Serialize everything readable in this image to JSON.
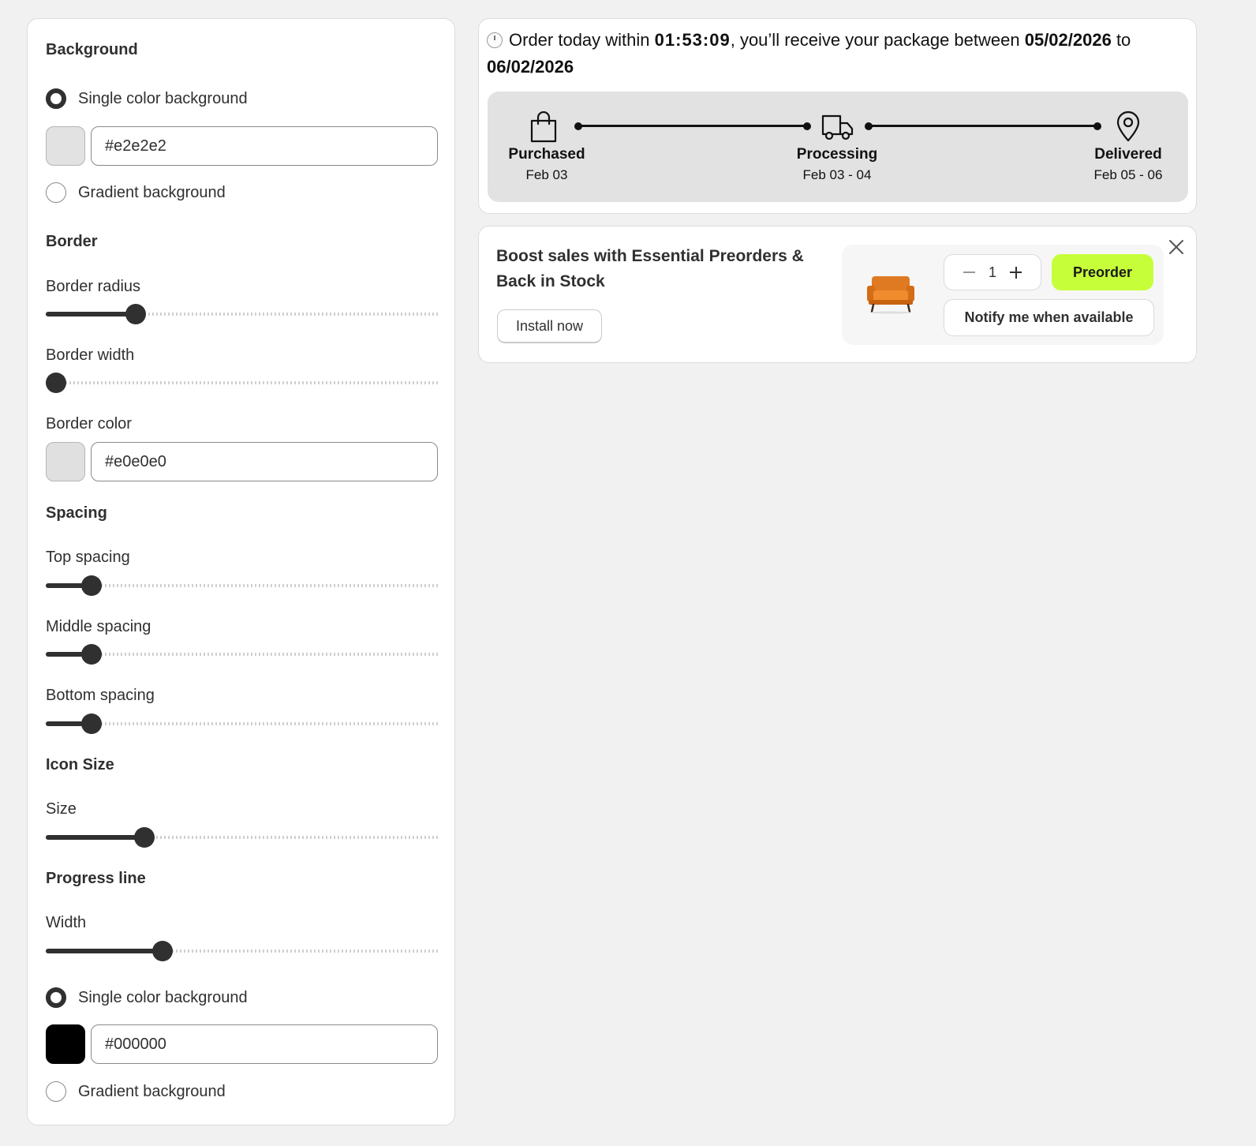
{
  "settings": {
    "background": {
      "title": "Background",
      "single_label": "Single color background",
      "single_selected": true,
      "color_swatch": "#e2e2e2",
      "color_value": "#e2e2e2",
      "gradient_label": "Gradient background"
    },
    "border": {
      "title": "Border",
      "radius_label": "Border radius",
      "radius_level": 0.214,
      "width_label": "Border width",
      "width_level": 0.0,
      "color_label": "Border color",
      "color_swatch": "#e0e0e0",
      "color_value": "#e0e0e0"
    },
    "spacing": {
      "title": "Spacing",
      "top_label": "Top spacing",
      "top_level": 0.095,
      "middle_label": "Middle spacing",
      "middle_level": 0.095,
      "bottom_label": "Bottom spacing",
      "bottom_level": 0.095
    },
    "icon_size": {
      "title": "Icon Size",
      "size_label": "Size",
      "size_level": 0.238
    },
    "progress_line": {
      "title": "Progress line",
      "width_label": "Width",
      "width_level": 0.286,
      "single_label": "Single color background",
      "single_selected": true,
      "color_swatch": "#000000",
      "color_value": "#000000",
      "gradient_label": "Gradient background"
    }
  },
  "preview": {
    "eta": {
      "prefix": "Order today within ",
      "countdown": "01:53:09",
      "middle": ", you’ll receive your package between ",
      "date_from": "05/02/2026",
      "connector": " to ",
      "date_to": "06/02/2026"
    },
    "timeline_bg": "#e2e2e2",
    "steps": [
      {
        "name": "Purchased",
        "date": "Feb 03",
        "icon": "shopping-bag-icon"
      },
      {
        "name": "Processing",
        "date": "Feb 03 - 04",
        "icon": "truck-icon"
      },
      {
        "name": "Delivered",
        "date": "Feb 05 - 06",
        "icon": "map-pin-icon"
      }
    ]
  },
  "promo": {
    "title": "Boost sales with Essential Preorders & Back in Stock",
    "install_label": "Install now",
    "quantity": "1",
    "preorder_label": "Preorder",
    "notify_label": "Notify me when available",
    "accent": "#c6ff3a"
  }
}
